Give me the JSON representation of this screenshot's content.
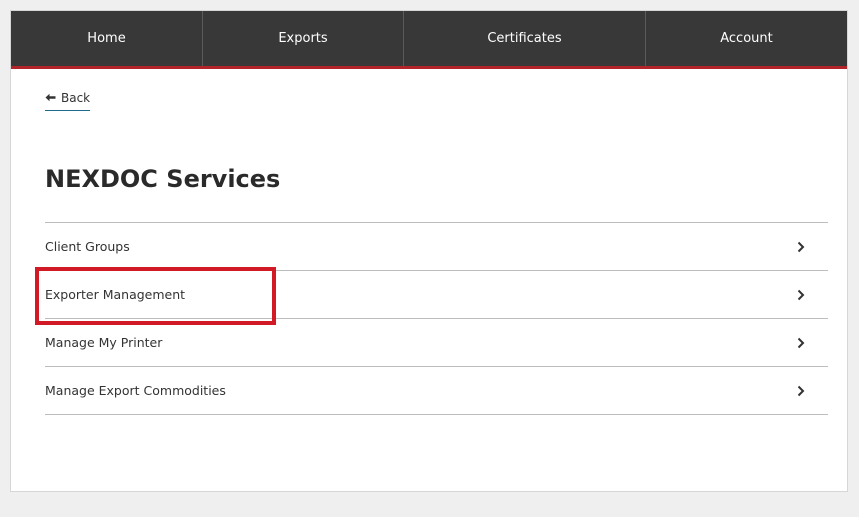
{
  "nav": {
    "items": [
      {
        "label": "Home"
      },
      {
        "label": "Exports"
      },
      {
        "label": "Certificates"
      },
      {
        "label": "Account"
      }
    ]
  },
  "back": {
    "icon": "arrow-left-icon",
    "label": "Back"
  },
  "page": {
    "title": "NEXDOC Services"
  },
  "services": [
    {
      "label": "Client Groups",
      "icon": "chevron-right-icon"
    },
    {
      "label": "Exporter Management",
      "icon": "chevron-right-icon",
      "highlighted": true
    },
    {
      "label": "Manage My Printer",
      "icon": "chevron-right-icon"
    },
    {
      "label": "Manage Export Commodities",
      "icon": "chevron-right-icon"
    }
  ],
  "colors": {
    "nav_background": "#383838",
    "nav_accent": "#b3232a",
    "highlight": "#d11a26",
    "link_underline": "#1d6a8f"
  }
}
